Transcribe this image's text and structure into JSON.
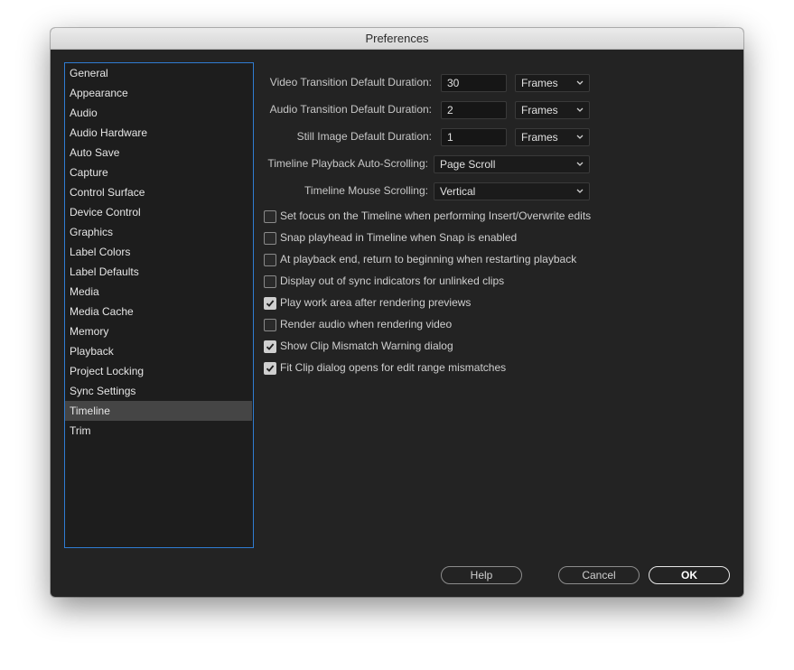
{
  "window": {
    "title": "Preferences"
  },
  "sidebar": {
    "items": [
      {
        "label": "General"
      },
      {
        "label": "Appearance"
      },
      {
        "label": "Audio"
      },
      {
        "label": "Audio Hardware"
      },
      {
        "label": "Auto Save"
      },
      {
        "label": "Capture"
      },
      {
        "label": "Control Surface"
      },
      {
        "label": "Device Control"
      },
      {
        "label": "Graphics"
      },
      {
        "label": "Label Colors"
      },
      {
        "label": "Label Defaults"
      },
      {
        "label": "Media"
      },
      {
        "label": "Media Cache"
      },
      {
        "label": "Memory"
      },
      {
        "label": "Playback"
      },
      {
        "label": "Project Locking"
      },
      {
        "label": "Sync Settings"
      },
      {
        "label": "Timeline",
        "selected": true
      },
      {
        "label": "Trim"
      }
    ]
  },
  "settings": {
    "video_transition": {
      "label": "Video Transition Default Duration:",
      "value": "30",
      "unit": "Frames"
    },
    "audio_transition": {
      "label": "Audio Transition Default Duration:",
      "value": "2",
      "unit": "Frames"
    },
    "still_image": {
      "label": "Still Image Default Duration:",
      "value": "1",
      "unit": "Frames"
    },
    "auto_scroll": {
      "label": "Timeline Playback Auto-Scrolling:",
      "value": "Page Scroll"
    },
    "mouse_scroll": {
      "label": "Timeline Mouse Scrolling:",
      "value": "Vertical"
    }
  },
  "checkboxes": [
    {
      "label": "Set focus on the Timeline when performing Insert/Overwrite edits",
      "checked": false
    },
    {
      "label": "Snap playhead in Timeline when Snap is enabled",
      "checked": false
    },
    {
      "label": "At playback end, return to beginning when restarting playback",
      "checked": false
    },
    {
      "label": "Display out of sync indicators for unlinked clips",
      "checked": false
    },
    {
      "label": "Play work area after rendering previews",
      "checked": true
    },
    {
      "label": "Render audio when rendering video",
      "checked": false
    },
    {
      "label": "Show Clip Mismatch Warning dialog",
      "checked": true
    },
    {
      "label": "Fit Clip dialog opens for edit range mismatches",
      "checked": true
    }
  ],
  "buttons": {
    "help": "Help",
    "cancel": "Cancel",
    "ok": "OK"
  }
}
